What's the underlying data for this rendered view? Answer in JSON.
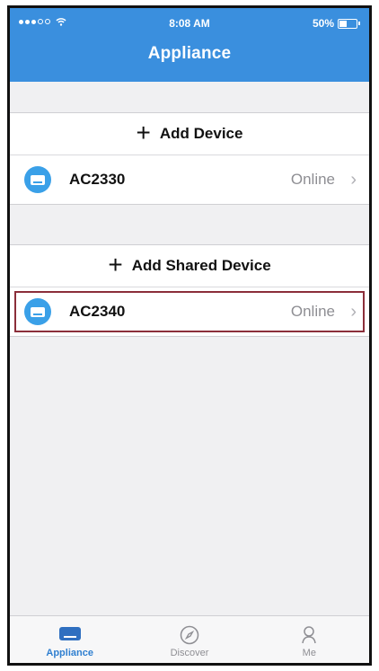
{
  "status_bar": {
    "carrier_dots": "●●●○○",
    "time": "8:08 AM",
    "battery_text": "50%",
    "battery_level": 0.5
  },
  "header": {
    "title": "Appliance"
  },
  "add_device": {
    "label": "Add Device",
    "icon": "plus-icon"
  },
  "devices": [
    {
      "name": "AC2330",
      "status": "Online",
      "icon": "air-conditioner-icon"
    }
  ],
  "add_shared_device": {
    "label": "Add Shared Device",
    "icon": "plus-icon"
  },
  "shared_devices": [
    {
      "name": "AC2340",
      "status": "Online",
      "icon": "air-conditioner-icon",
      "highlighted": true
    }
  ],
  "chevron": "›",
  "tabs": [
    {
      "label": "Appliance",
      "icon": "appliance-icon",
      "active": true
    },
    {
      "label": "Discover",
      "icon": "compass-icon",
      "active": false
    },
    {
      "label": "Me",
      "icon": "person-icon",
      "active": false
    }
  ],
  "colors": {
    "header": "#3a8fde",
    "accent": "#2f7fd0",
    "highlight_border": "#8b2e3a"
  }
}
